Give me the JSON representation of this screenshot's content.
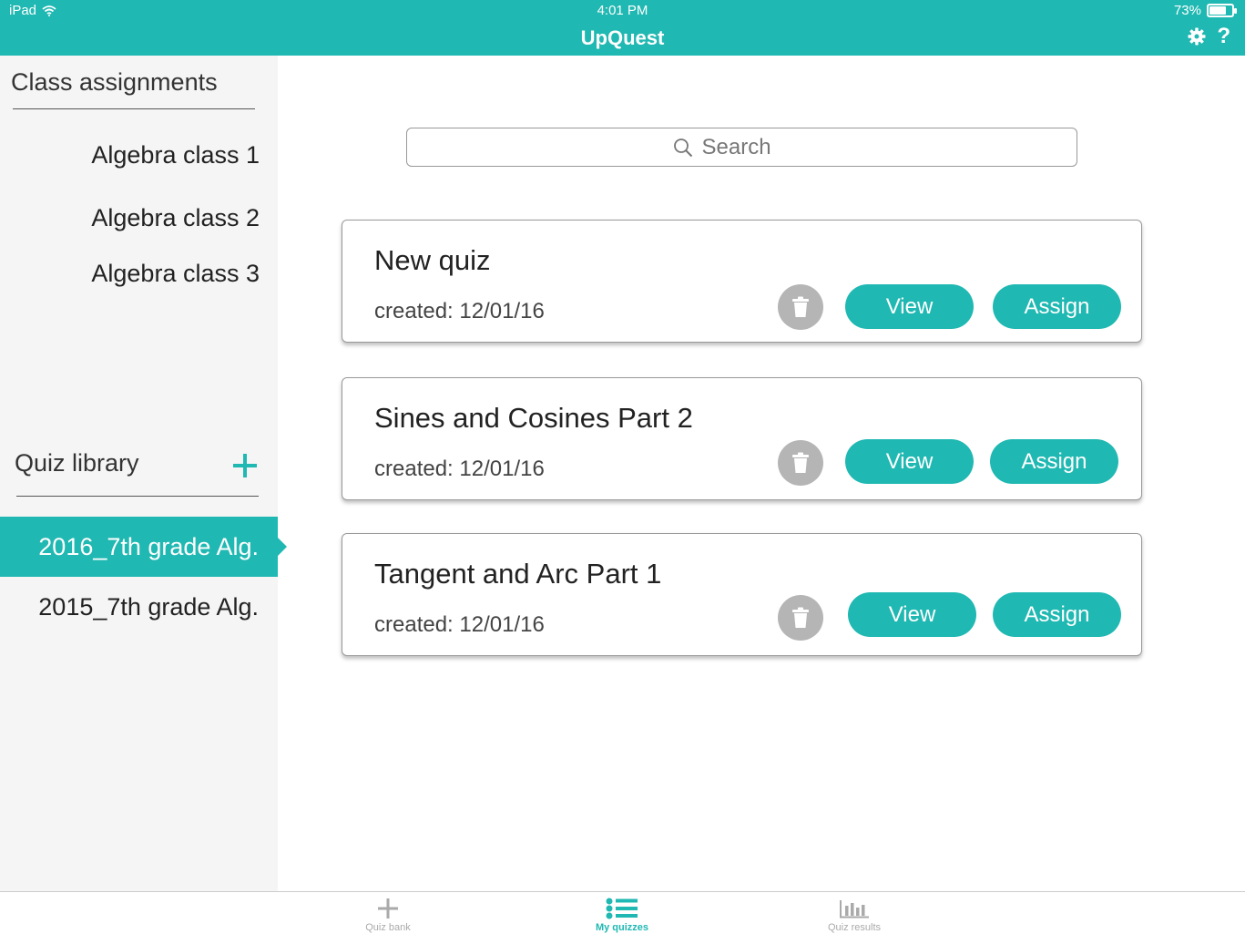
{
  "status_bar": {
    "device": "iPad",
    "time": "4:01 PM",
    "battery": "73%",
    "battery_level": 0.73
  },
  "header": {
    "title": "UpQuest",
    "settings_icon": "gear-icon",
    "help_label": "?"
  },
  "sidebar": {
    "class_heading": "Class assignments",
    "classes": [
      {
        "label": "Algebra class 1"
      },
      {
        "label": "Algebra class 2"
      },
      {
        "label": "Algebra class 3"
      }
    ],
    "library_heading": "Quiz library",
    "add_icon": "plus-icon",
    "libraries": [
      {
        "label": "2016_7th grade Alg.",
        "selected": true
      },
      {
        "label": "2015_7th grade Alg.",
        "selected": false
      }
    ]
  },
  "search": {
    "placeholder": "Search",
    "icon": "search-icon"
  },
  "quizzes": [
    {
      "title": "New quiz",
      "created": "created: 12/01/16",
      "view_label": "View",
      "assign_label": "Assign"
    },
    {
      "title": "Sines and Cosines Part 2",
      "created": "created: 12/01/16",
      "view_label": "View",
      "assign_label": "Assign"
    },
    {
      "title": "Tangent and Arc Part 1",
      "created": "created: 12/01/16",
      "view_label": "View",
      "assign_label": "Assign"
    }
  ],
  "tabs": [
    {
      "label": "Quiz bank",
      "icon": "plus-icon",
      "active": false
    },
    {
      "label": "My quizzes",
      "icon": "list-icon",
      "active": true
    },
    {
      "label": "Quiz results",
      "icon": "bar-chart-icon",
      "active": false
    }
  ],
  "colors": {
    "accent": "#20b8b2",
    "sidebar_bg": "#f5f5f5",
    "trash_bg": "#b5b5b5"
  }
}
